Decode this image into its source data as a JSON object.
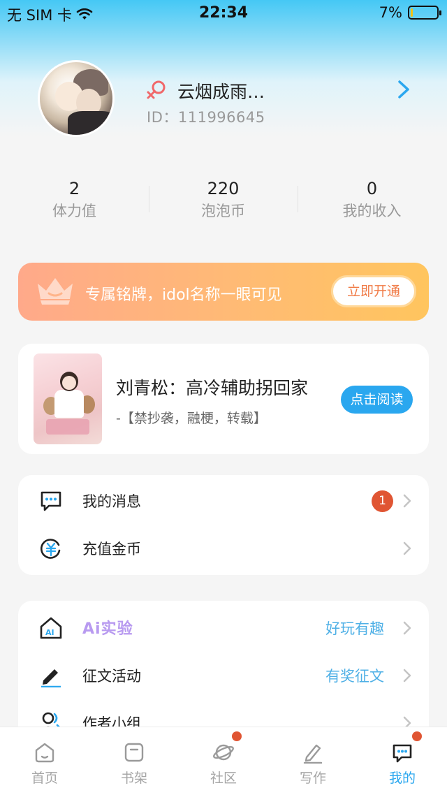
{
  "status_bar": {
    "carrier": "无 SIM 卡",
    "time": "22:34",
    "battery_percent_text": "7%",
    "battery_level": 0.07,
    "wifi_icon": "wifi-icon"
  },
  "profile": {
    "username": "云烟成雨…",
    "user_id": "ID：111996645",
    "gender_icon": "female-icon",
    "gender_color": "#f0686a"
  },
  "stats": [
    {
      "value": "2",
      "label": "体力值"
    },
    {
      "value": "220",
      "label": "泡泡币"
    },
    {
      "value": "0",
      "label": "我的收入"
    }
  ],
  "vip_banner": {
    "text": "专属铭牌，idol名称一眼可见",
    "button": "立即开通",
    "icon": "crown-icon"
  },
  "book": {
    "title": "刘青松：高冷辅助拐回家",
    "subtitle": "-【禁抄袭，融梗，转载】",
    "button": "点击阅读"
  },
  "menu_group_1": [
    {
      "label": "我的消息",
      "icon": "message-icon",
      "badge": "1"
    },
    {
      "label": "充值金币",
      "icon": "coin-icon"
    }
  ],
  "menu_group_2": [
    {
      "label": "Ai实验",
      "icon": "ai-home-icon",
      "right_text": "好玩有趣"
    },
    {
      "label": "征文活动",
      "icon": "pen-icon",
      "right_text": "有奖征文"
    },
    {
      "label": "作者小组",
      "icon": "author-group-icon"
    }
  ],
  "tab_bar": [
    {
      "label": "首页",
      "icon": "home-icon",
      "active": false
    },
    {
      "label": "书架",
      "icon": "bookshelf-icon",
      "active": false
    },
    {
      "label": "社区",
      "icon": "planet-icon",
      "active": false,
      "dot": true
    },
    {
      "label": "写作",
      "icon": "write-icon",
      "active": false
    },
    {
      "label": "我的",
      "icon": "mine-icon",
      "active": true,
      "dot": true
    }
  ],
  "colors": {
    "accent": "#2aa7ef",
    "badge": "#e05533",
    "vip_gradient_start": "#ffa98a",
    "vip_gradient_end": "#ffc55e"
  }
}
